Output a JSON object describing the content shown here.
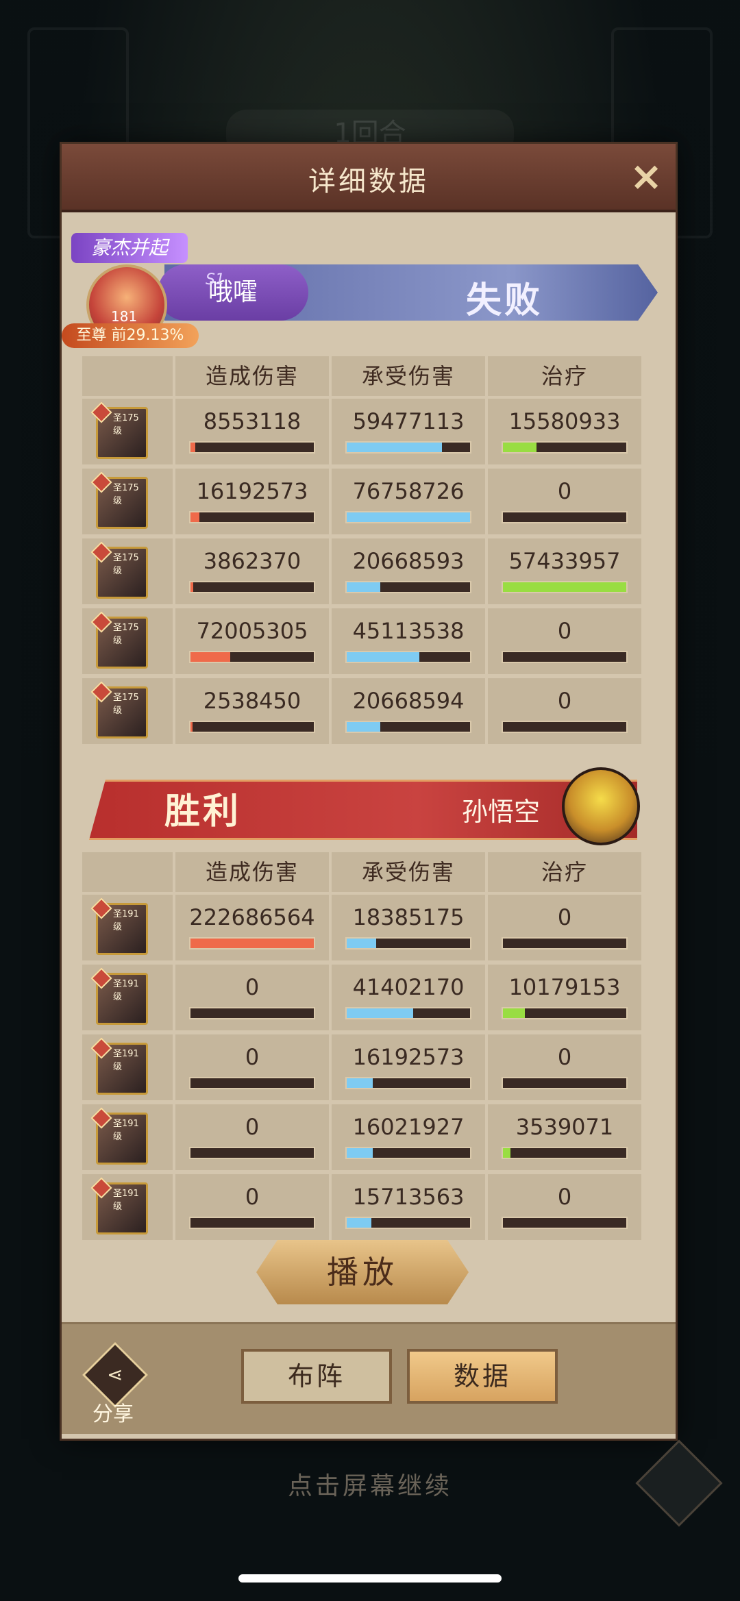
{
  "panel": {
    "title": "详细数据",
    "close_icon": "×"
  },
  "background": {
    "round_label": "1回合"
  },
  "losing_team": {
    "title_badge": "豪杰并起",
    "player_name": "哦嚯",
    "season": "S1",
    "result": "失败",
    "level": "181",
    "rank": "至尊 前29.13%",
    "headers": [
      "造成伤害",
      "承受伤害",
      "治疗"
    ],
    "rows": [
      {
        "level": "圣175级",
        "damage": "8553118",
        "taken": "59477113",
        "heal": "15580933",
        "damage_pct": 0.04,
        "taken_pct": 0.77,
        "heal_pct": 0.27
      },
      {
        "level": "圣175级",
        "damage": "16192573",
        "taken": "76758726",
        "heal": "0",
        "damage_pct": 0.07,
        "taken_pct": 1.0,
        "heal_pct": 0
      },
      {
        "level": "圣175级",
        "damage": "3862370",
        "taken": "20668593",
        "heal": "57433957",
        "damage_pct": 0.02,
        "taken_pct": 0.27,
        "heal_pct": 1.0
      },
      {
        "level": "圣175级",
        "damage": "72005305",
        "taken": "45113538",
        "heal": "0",
        "damage_pct": 0.32,
        "taken_pct": 0.59,
        "heal_pct": 0
      },
      {
        "level": "圣175级",
        "damage": "2538450",
        "taken": "20668594",
        "heal": "0",
        "damage_pct": 0.01,
        "taken_pct": 0.27,
        "heal_pct": 0
      }
    ]
  },
  "winning_team": {
    "result": "胜利",
    "player_name": "孙悟空",
    "headers": [
      "造成伤害",
      "承受伤害",
      "治疗"
    ],
    "rows": [
      {
        "level": "圣191级",
        "damage": "222686564",
        "taken": "18385175",
        "heal": "0",
        "damage_pct": 1.0,
        "taken_pct": 0.24,
        "heal_pct": 0
      },
      {
        "level": "圣191级",
        "damage": "0",
        "taken": "41402170",
        "heal": "10179153",
        "damage_pct": 0,
        "taken_pct": 0.54,
        "heal_pct": 0.18
      },
      {
        "level": "圣191级",
        "damage": "0",
        "taken": "16192573",
        "heal": "0",
        "damage_pct": 0,
        "taken_pct": 0.21,
        "heal_pct": 0
      },
      {
        "level": "圣191级",
        "damage": "0",
        "taken": "16021927",
        "heal": "3539071",
        "damage_pct": 0,
        "taken_pct": 0.21,
        "heal_pct": 0.06
      },
      {
        "level": "圣191级",
        "damage": "0",
        "taken": "15713563",
        "heal": "0",
        "damage_pct": 0,
        "taken_pct": 0.2,
        "heal_pct": 0
      }
    ]
  },
  "buttons": {
    "play": "播放",
    "formation": "布阵",
    "data": "数据",
    "share": "分享"
  },
  "footer": {
    "continue": "点击屏幕继续"
  },
  "colors": {
    "damage": "#ef6a4a",
    "taken": "#7ecbf2",
    "heal": "#99dd42"
  }
}
